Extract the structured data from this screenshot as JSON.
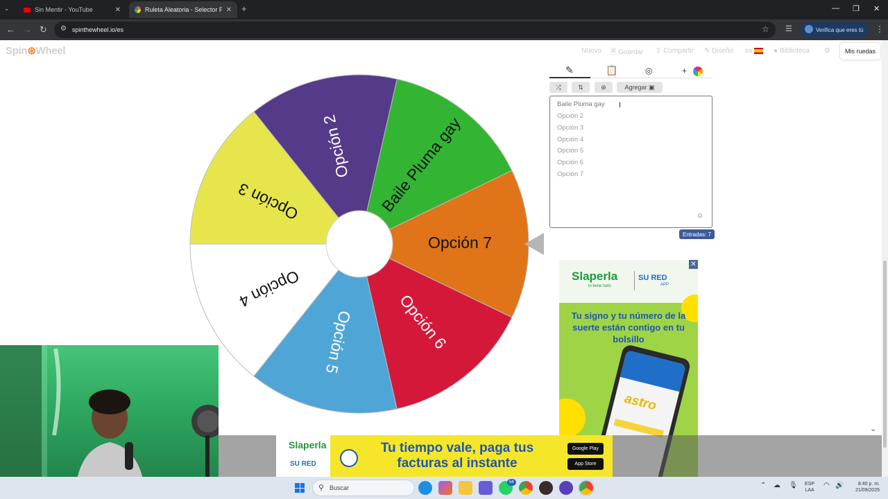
{
  "browser": {
    "tabs": [
      {
        "title": "Sin Mentir - YouTube",
        "active": false
      },
      {
        "title": "Ruleta Aleatoria - Selector Pers",
        "active": true
      }
    ],
    "new_tab_symbol": "+",
    "url": "spinthewheel.io/es",
    "verify_button": "Verifica que eres tú"
  },
  "site": {
    "logo_pre": "Spin",
    "logo_post": "Wheel",
    "nav": {
      "nuevo": "Nuevo",
      "guardar": "Guardar",
      "compartir": "Compartir",
      "diseno": "Diseño",
      "language": "es",
      "biblioteca": "Biblioteca"
    },
    "mis_ruedas": "Mis ruedas"
  },
  "wheel": {
    "segments": [
      {
        "label": "Baile Pluma gay",
        "color": "#33b533"
      },
      {
        "label": "Opción 2",
        "color": "#553a8a"
      },
      {
        "label": "Opción 3",
        "color": "#e6e64c"
      },
      {
        "label": "Opción 4",
        "color": "#ffffff"
      },
      {
        "label": "Opción 5",
        "color": "#4fa6d6"
      },
      {
        "label": "Opción 6",
        "color": "#d4183a"
      },
      {
        "label": "Opción 7",
        "color": "#e07418"
      }
    ]
  },
  "editor": {
    "add_button": "Agregar",
    "entries": [
      "Baile Pluma gay",
      "Opción 2",
      "Opción 3",
      "Opción 4",
      "Opción 5",
      "Opción 6",
      "Opción 7"
    ],
    "entries_badge": "Entradas: 7"
  },
  "ads": {
    "right": {
      "brand1": "laperla",
      "brand1_tag": "lo tiene todo",
      "brand2": "SU RED",
      "brand2_tag": "APP",
      "headline": "Tu signo y tu número de la suerte están contigo en tu bolsillo",
      "product": "astro"
    },
    "bottom": {
      "brand1": "laperla",
      "brand2": "SU RED",
      "headline": "Tu tiempo vale, paga tus facturas al instante",
      "store1": "Google Play",
      "store2": "App Store"
    }
  },
  "taskbar": {
    "search_placeholder": "Buscar",
    "whatsapp_badge": "54",
    "lang_line1": "ESP",
    "lang_line2": "LAA",
    "time": "8:40 p. m.",
    "date": "21/09/2025"
  }
}
